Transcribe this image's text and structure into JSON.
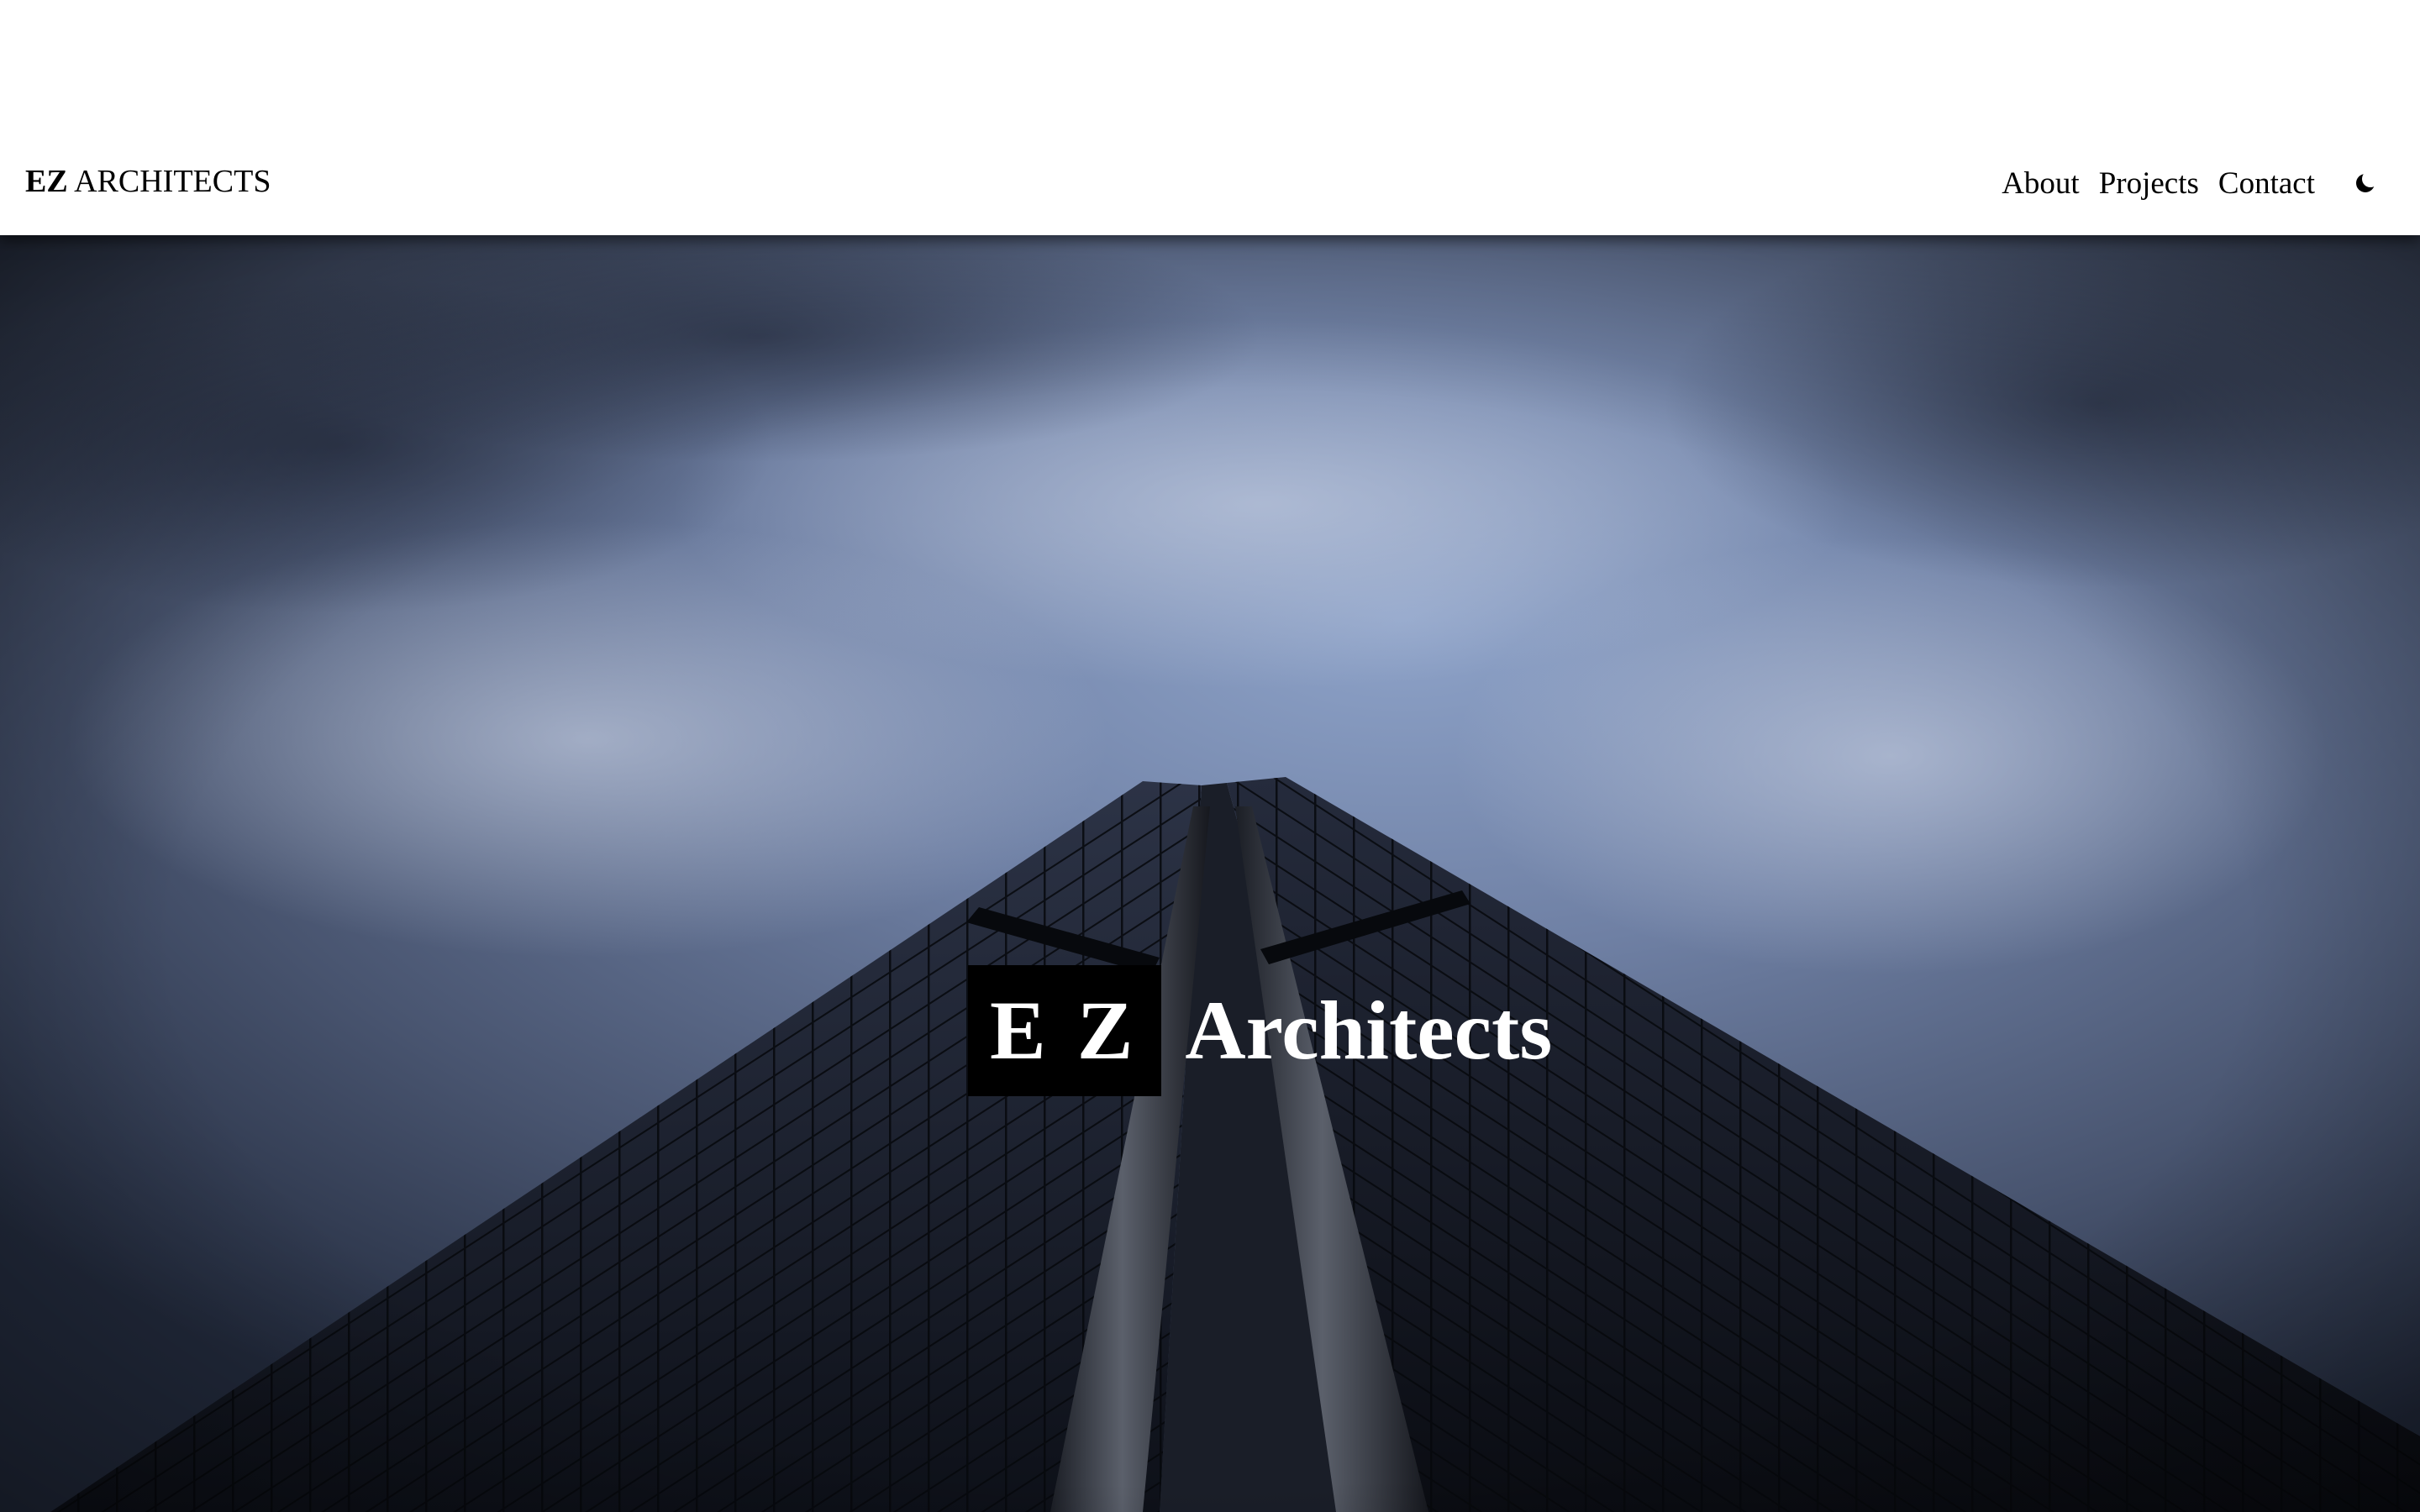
{
  "navbar": {
    "brand_strong": "EZ",
    "brand_rest": "ARCHITECTS",
    "links": [
      "About",
      "Projects",
      "Contact"
    ],
    "theme_toggle_icon": "moon-icon"
  },
  "hero": {
    "title_mark": "E Z",
    "title_word": "Architects",
    "background_image": "low-angle skyscraper against cloudy sky"
  },
  "colors": {
    "navbar_bg": "#ffffff",
    "text": "#000000",
    "hero_text": "#ffffff",
    "mark_bg": "#000000"
  }
}
